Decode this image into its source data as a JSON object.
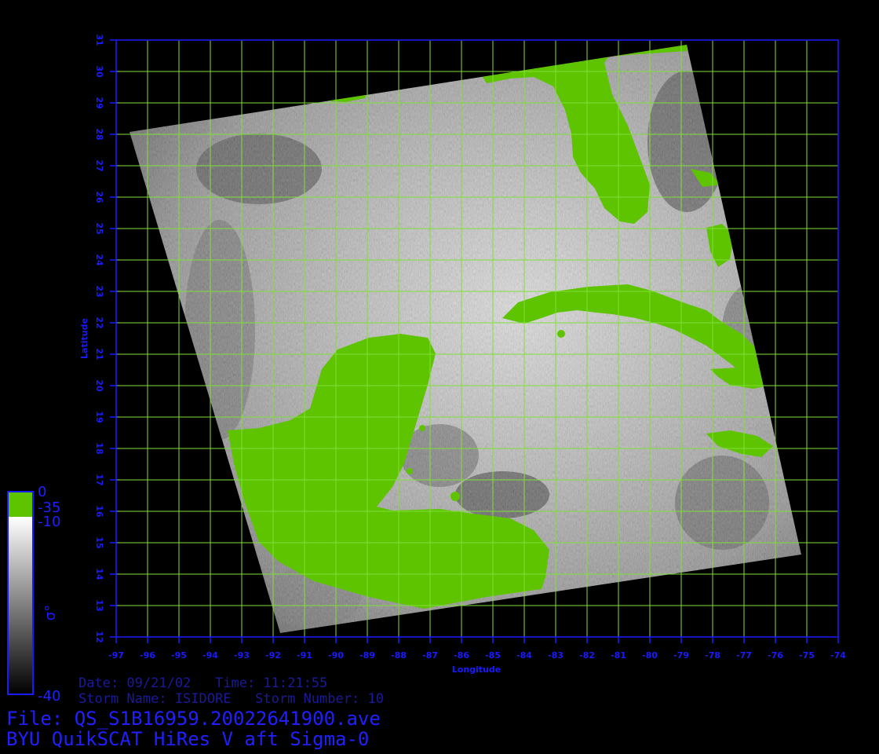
{
  "colors": {
    "background": "#000000",
    "axis": "#1a1aff",
    "grid": "#7fe03a",
    "land": "#5ec400",
    "text": "#2020ff"
  },
  "axes": {
    "x_label": "Longitude",
    "y_label": "Latitude",
    "x_ticks": [
      "-97",
      "-96",
      "-95",
      "-94",
      "-93",
      "-92",
      "-91",
      "-90",
      "-89",
      "-88",
      "-87",
      "-86",
      "-85",
      "-84",
      "-83",
      "-82",
      "-81",
      "-80",
      "-79",
      "-78",
      "-77",
      "-76",
      "-75",
      "-74"
    ],
    "y_ticks": [
      "12",
      "13",
      "14",
      "15",
      "16",
      "17",
      "18",
      "19",
      "20",
      "21",
      "22",
      "23",
      "24",
      "25",
      "26",
      "27",
      "28",
      "29",
      "30",
      "31"
    ],
    "lon_range": [
      -97,
      -74
    ],
    "lat_range": [
      12,
      31
    ]
  },
  "colorbar": {
    "label_top": "0",
    "label_35": "-35",
    "label_10": "-10",
    "label_bottom": "-40",
    "symbol": "σ°"
  },
  "info": {
    "date_line": "Date: 09/21/02   Time: 11:21:55",
    "storm_line": "Storm Name: ISIDORE   Storm Number: 10",
    "file_line": "File: QS_S1B16959.20022641900.ave",
    "title_line": "BYU QuikSCAT HiRes V aft Sigma-0"
  }
}
